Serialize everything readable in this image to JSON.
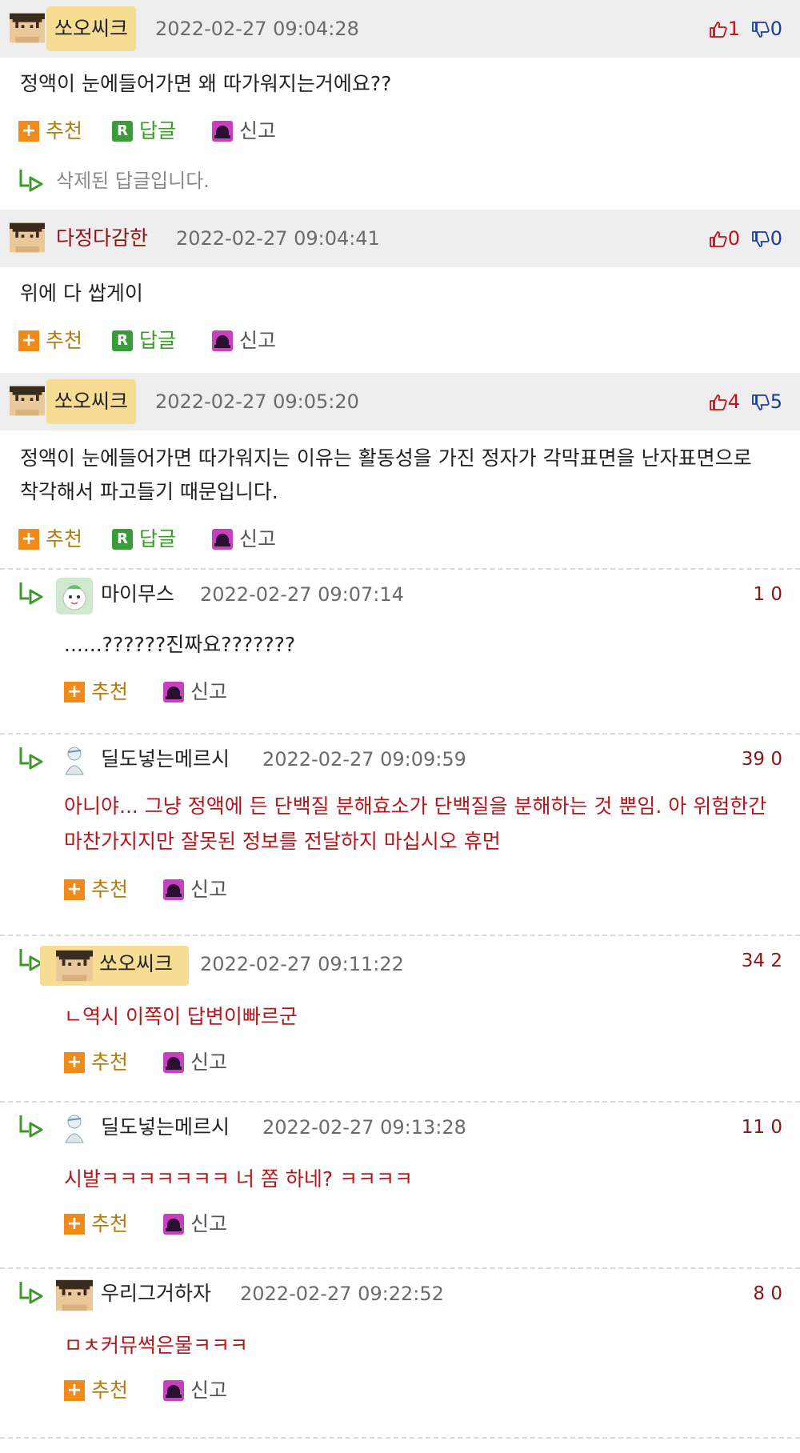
{
  "labels": {
    "recommend": "추천",
    "reply": "답글",
    "report": "신고"
  },
  "comments": [
    {
      "nick": "쏘오씨크",
      "date": "2022-02-27 09:04:28",
      "up": "1",
      "down": "0",
      "text": "정액이 눈에들어가면 왜 따가워지는거에요??"
    },
    {
      "nick": "다정다감한",
      "date": "2022-02-27 09:04:41",
      "up": "0",
      "down": "0",
      "text": "위에 다 쌉게이"
    },
    {
      "nick": "쏘오씨크",
      "date": "2022-02-27 09:05:20",
      "up": "4",
      "down": "5",
      "text": "정액이 눈에들어가면 따가워지는 이유는 활동성을 가진 정자가 각막표면을 난자표면으로 착각해서 파고들기 때문입니다."
    }
  ],
  "deleted_reply": "삭제된 답글입니다.",
  "replies": [
    {
      "nick": "마이무스",
      "date": "2022-02-27 09:07:14",
      "votes": "1 0",
      "text": "......??????진짜요???????"
    },
    {
      "nick": "딜도넣는메르시",
      "date": "2022-02-27 09:09:59",
      "votes": "39 0",
      "text": "아니야... 그냥 정액에 든 단백질 분해효소가 단백질을 분해하는 것 뿐임. 아 위험한간 마찬가지지만 잘못된 정보를 전달하지 마십시오 휴먼"
    },
    {
      "nick": "쏘오씨크",
      "date": "2022-02-27 09:11:22",
      "votes": "34 2",
      "text": "ㄴ역시 이쪽이 답변이빠르군"
    },
    {
      "nick": "딜도넣는메르시",
      "date": "2022-02-27 09:13:28",
      "votes": "11 0",
      "text": "시발ㅋㅋㅋㅋㅋㅋㅋ 너 쫌 하네? ㅋㅋㅋㅋ"
    },
    {
      "nick": "우리그거하자",
      "date": "2022-02-27 09:22:52",
      "votes": "8 0",
      "text": "ㅁㅊ커뮤썩은물ㅋㅋㅋ"
    }
  ],
  "icons": {
    "thumbs_up": "thumbs-up-icon",
    "thumbs_down": "thumbs-down-icon",
    "plus": "plus-icon",
    "reply_badge": "reply-r-icon",
    "siren": "siren-icon",
    "reply_arrow": "reply-arrow-icon"
  },
  "colors": {
    "header_bg": "#eeeeee",
    "highlight": "#f7dd94",
    "recommend": "#b87a0c",
    "reply": "#3c9a29",
    "up": "#c3121c",
    "down": "#1e3c9e",
    "red_text": "#b5161b"
  }
}
